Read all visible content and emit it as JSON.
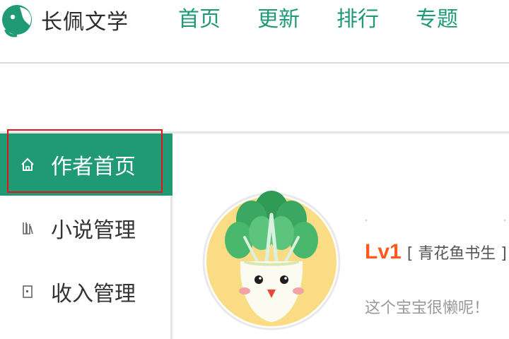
{
  "brand": {
    "name": "长佩文学",
    "accent": "#1f9a74"
  },
  "nav": [
    {
      "label": "首页"
    },
    {
      "label": "更新"
    },
    {
      "label": "排行"
    },
    {
      "label": "专题"
    }
  ],
  "sidebar": {
    "items": [
      {
        "label": "作者首页",
        "icon": "home-icon",
        "active": true
      },
      {
        "label": "小说管理",
        "icon": "novel-icon",
        "active": false
      },
      {
        "label": "收入管理",
        "icon": "income-icon",
        "active": false
      }
    ],
    "highlight_color": "#e0151b"
  },
  "profile": {
    "avatar": "cabbage-avatar",
    "level": "Lv1",
    "level_title": "[ 青花鱼书生 ]",
    "bio": "这个宝宝很懒呢！",
    "level_color": "#ff5a1a"
  }
}
